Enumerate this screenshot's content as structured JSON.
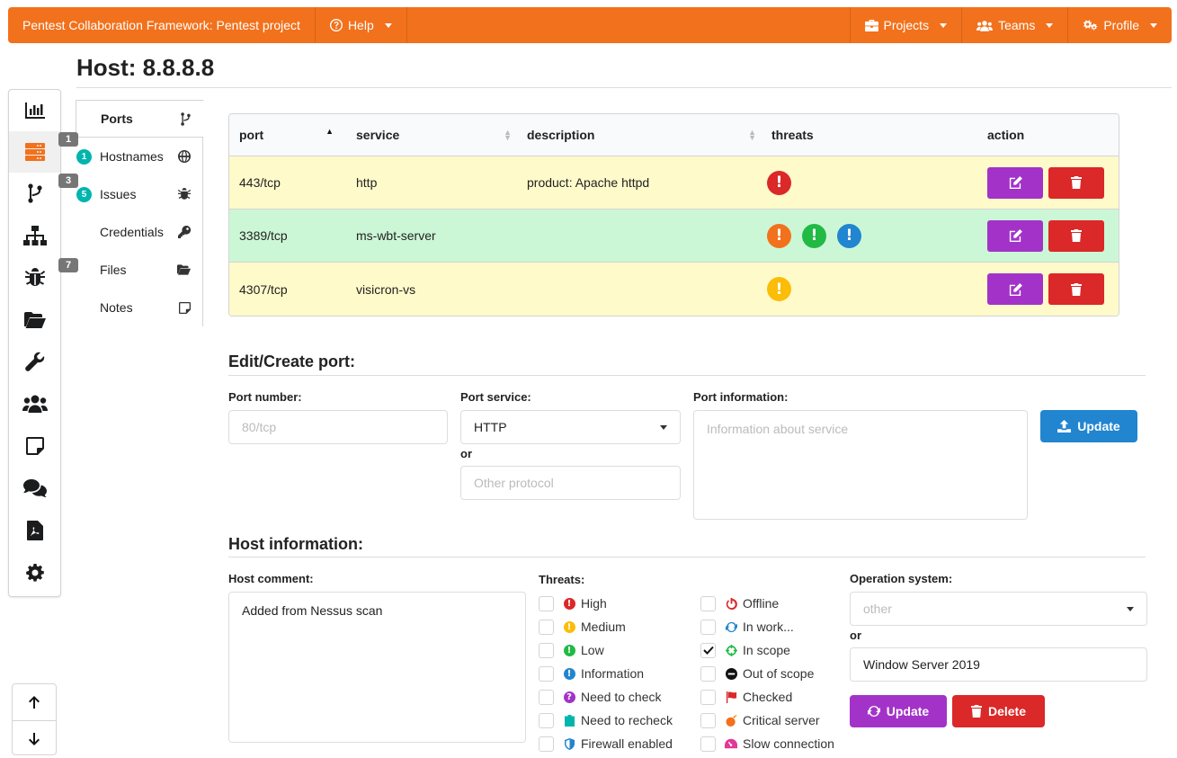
{
  "topbar": {
    "app_title": "Pentest Collaboration Framework: Pentest project",
    "help": "Help",
    "projects": "Projects",
    "teams": "Teams",
    "profile": "Profile"
  },
  "page": {
    "title": "Host: 8.8.8.8"
  },
  "sidebar": {
    "badges": {
      "hosts": "1",
      "network": "3",
      "issues": "7"
    }
  },
  "submenu": {
    "items": [
      {
        "label": "Ports",
        "count": ""
      },
      {
        "label": "Hostnames",
        "count": "1"
      },
      {
        "label": "Issues",
        "count": "5"
      },
      {
        "label": "Credentials",
        "count": ""
      },
      {
        "label": "Files",
        "count": ""
      },
      {
        "label": "Notes",
        "count": ""
      }
    ]
  },
  "ports_table": {
    "headers": [
      "port",
      "service",
      "description",
      "threats",
      "action"
    ],
    "rows": [
      {
        "port": "443/tcp",
        "service": "http",
        "description": "product: Apache httpd",
        "color": "#fffaca"
      },
      {
        "port": "3389/tcp",
        "service": "ms-wbt-server",
        "description": "",
        "color": "#ccf7d6"
      },
      {
        "port": "4307/tcp",
        "service": "visicron-vs",
        "description": "",
        "color": "#fffaca"
      }
    ]
  },
  "edit_port": {
    "heading": "Edit/Create port:",
    "port_number_label": "Port number:",
    "port_number_placeholder": "80/tcp",
    "port_service_label": "Port service:",
    "port_service_value": "HTTP",
    "or_label": "or",
    "other_protocol_placeholder": "Other protocol",
    "port_info_label": "Port information:",
    "port_info_placeholder": "Information about service",
    "update_label": "Update"
  },
  "host_info": {
    "heading": "Host information:",
    "comment_label": "Host comment:",
    "comment_value": "Added from Nessus scan",
    "threats_label": "Threats:",
    "threats_left": [
      "High",
      "Medium",
      "Low",
      "Information",
      "Need to check",
      "Need to recheck",
      "Firewall enabled"
    ],
    "threats_right": [
      "Offline",
      "In work...",
      "In scope",
      "Out of scope",
      "Checked",
      "Critical server",
      "Slow connection"
    ],
    "os_label": "Operation system:",
    "os_select_value": "other",
    "or_label": "or",
    "os_input_value": "Window Server 2019",
    "update_label": "Update",
    "delete_label": "Delete"
  },
  "colors": {
    "brand": "#f2711c",
    "purple": "#a333c8",
    "red": "#db2828",
    "blue": "#2185d0",
    "teal": "#00b5ad",
    "orange": "#f2711c",
    "green": "#21ba45",
    "yellow": "#fbbd08"
  }
}
